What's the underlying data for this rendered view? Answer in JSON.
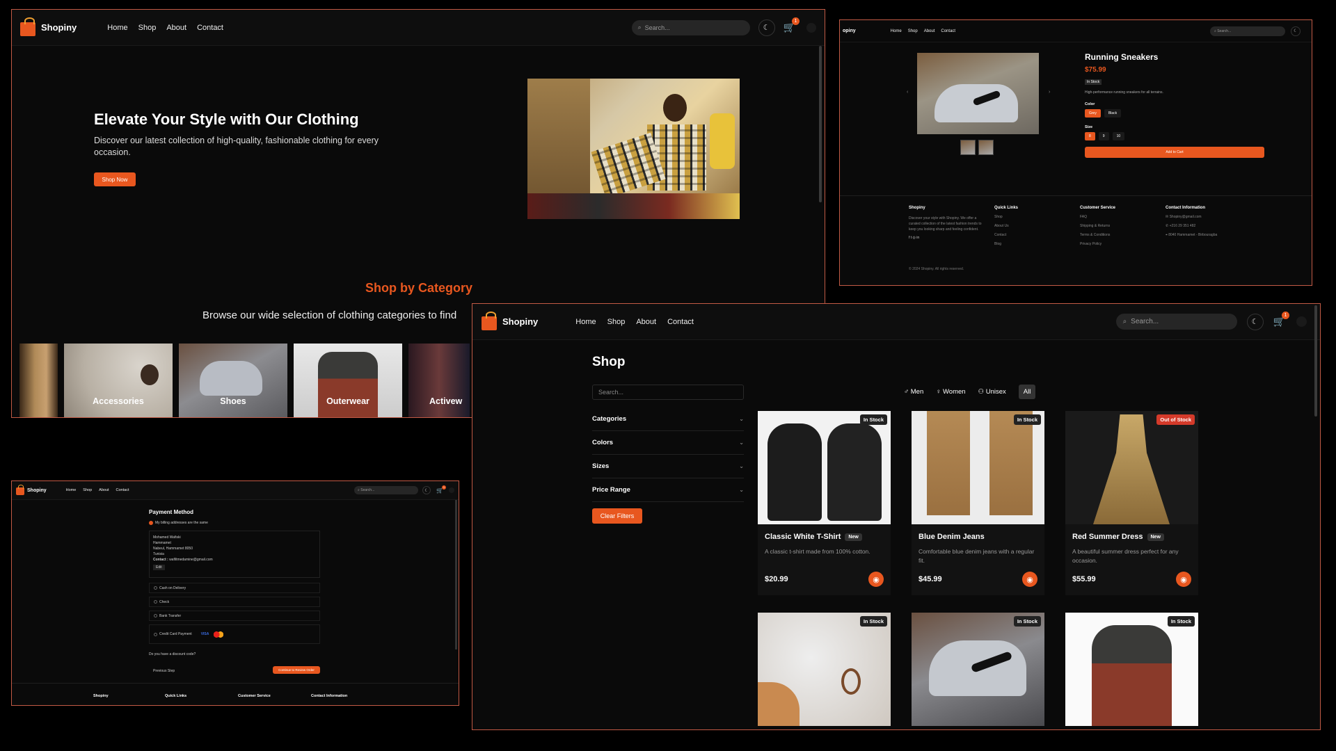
{
  "brand": "Shopiny",
  "nav": [
    "Home",
    "Shop",
    "About",
    "Contact"
  ],
  "search_placeholder": "Search...",
  "cart_count": "1",
  "home": {
    "hero_title": "Elevate Your Style with Our Clothing",
    "hero_subtitle": "Discover our latest collection of high-quality, fashionable clothing for every occasion.",
    "hero_button": "Shop Now",
    "category_title": "Shop by Category",
    "category_subtitle": "Browse our wide selection of clothing categories to find",
    "categories": [
      "",
      "Accessories",
      "Shoes",
      "Outerwear",
      "Activew"
    ]
  },
  "product": {
    "brand_partial": "opiny",
    "name": "Running Sneakers",
    "price": "$75.99",
    "stock": "In Stock",
    "description": "High-performance running sneakers for all terrains.",
    "color_label": "Color",
    "colors": [
      "Grey",
      "Black"
    ],
    "size_label": "Size",
    "sizes": [
      "8",
      "9",
      "10"
    ],
    "add_to_cart": "Add to Cart",
    "footer": {
      "about_title": "Shopiny",
      "about_text": "Discover your style with Shopiny. We offer a curated collection of the latest fashion trends to keep you looking sharp and feeling confident.",
      "social": "f  t  ◎  in",
      "quick_title": "Quick Links",
      "quick_links": [
        "Shop",
        "About Us",
        "Contact",
        "Blog"
      ],
      "service_title": "Customer Service",
      "service_links": [
        "FAQ",
        "Shipping & Returns",
        "Terms & Conditions",
        "Privacy Policy"
      ],
      "contact_title": "Contact Information",
      "contact": [
        "Shopiny@gmail.com",
        "+216 29 351 482",
        "8040 Hammamet - Birbouragba"
      ],
      "copyright": "© 2024 Shopiny. All rights reserved."
    }
  },
  "payment": {
    "title": "Payment Method",
    "same_address": "My billing addresses are the same",
    "address_lines": [
      "Mohamed Wafiski",
      "Hammamet",
      "Nabeul, Hammamet 8050",
      "Tunisia"
    ],
    "contact_label": "Contact :",
    "contact_value": "wafiltmedamine@gmail.com",
    "edit": "Edit",
    "options": [
      "Cash on Delivery",
      "Check",
      "Bank Transfer",
      "Credit Card Payment"
    ],
    "visa": "VISA",
    "discount": "Do you have a discount code?",
    "previous": "Previous Step",
    "continue": "Continue to Review Order",
    "footer": [
      "Shopiny",
      "Quick Links",
      "Customer Service",
      "Contact Information"
    ]
  },
  "shop": {
    "title": "Shop",
    "filter_search": "Search...",
    "filters": [
      "Categories",
      "Colors",
      "Sizes",
      "Price Range"
    ],
    "clear": "Clear Filters",
    "tabs": [
      "Men",
      "Women",
      "Unisex",
      "All"
    ],
    "products": [
      {
        "name": "Classic White T-Shirt",
        "badge": "New",
        "stock": "In Stock",
        "desc": "A classic t-shirt made from 100% cotton.",
        "price": "$20.99"
      },
      {
        "name": "Blue Denim Jeans",
        "badge": "",
        "stock": "In Stock",
        "desc": "Comfortable blue denim jeans with a regular fit.",
        "price": "$45.99"
      },
      {
        "name": "Red Summer Dress",
        "badge": "New",
        "stock": "Out of Stock",
        "desc": "A beautiful summer dress perfect for any occasion.",
        "price": "$55.99"
      },
      {
        "name": "",
        "badge": "",
        "stock": "In Stock",
        "desc": "",
        "price": ""
      },
      {
        "name": "",
        "badge": "",
        "stock": "In Stock",
        "desc": "",
        "price": ""
      },
      {
        "name": "",
        "badge": "",
        "stock": "In Stock",
        "desc": "",
        "price": ""
      }
    ]
  }
}
